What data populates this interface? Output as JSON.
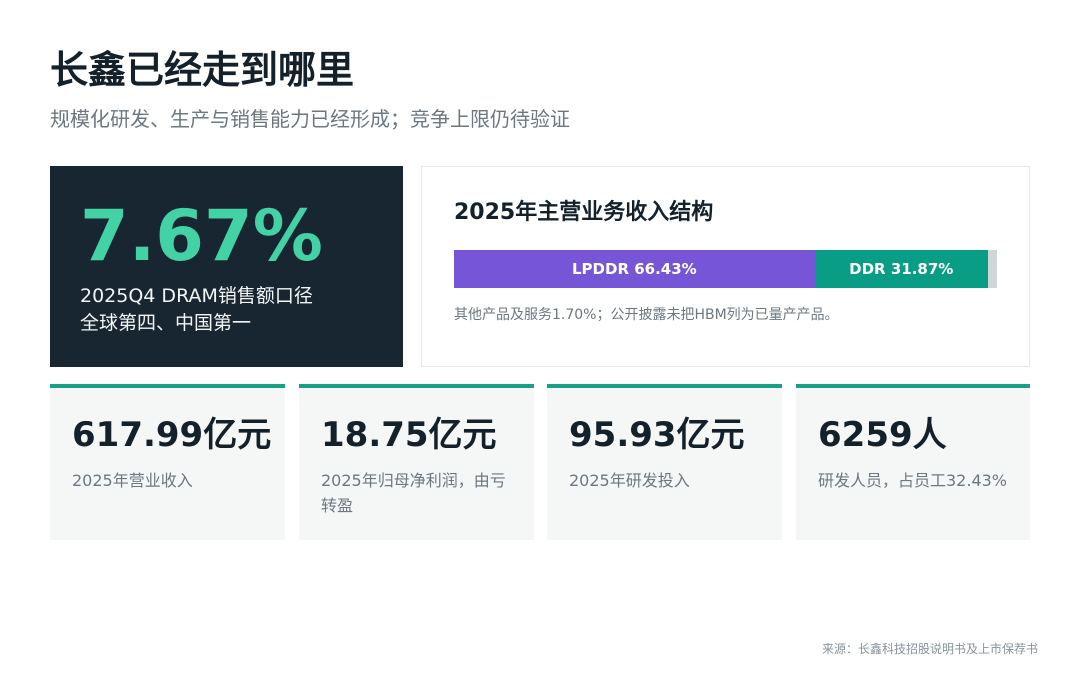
{
  "header": {
    "title": "长鑫已经走到哪里",
    "subtitle": "规模化研发、生产与销售能力已经形成；竞争上限仍待验证"
  },
  "highlight": {
    "value": "7.67%",
    "description_line1": "2025Q4 DRAM销售额口径",
    "description_line2": "全球第四、中国第一"
  },
  "revenue_structure": {
    "title": "2025年主营业务收入结构",
    "segments": [
      {
        "name": "LPDDR",
        "label": "LPDDR 66.43%",
        "share": 66.43,
        "color": "#7655d6"
      },
      {
        "name": "DDR",
        "label": "DDR 31.87%",
        "share": 31.87,
        "color": "#0a9d86"
      },
      {
        "name": "其他产品及服务",
        "label": "",
        "share": 1.7,
        "color": "#d1d7d9"
      }
    ],
    "note": "其他产品及服务1.70%；公开披露未把HBM列为已量产产品。"
  },
  "metrics": [
    {
      "value": "617.99亿元",
      "label": "2025年营业收入"
    },
    {
      "value": "18.75亿元",
      "label": "2025年归母净利润，由亏转盈"
    },
    {
      "value": "95.93亿元",
      "label": "2025年研发投入"
    },
    {
      "value": "6259人",
      "label": "研发人员，占员工32.43%"
    }
  ],
  "source": "来源：长鑫科技招股说明书及上市保荐书",
  "colors": {
    "accent_green": "#43d1a6",
    "accent_teal": "#16a085",
    "dark_card": "#172630",
    "purple": "#7655d6"
  }
}
